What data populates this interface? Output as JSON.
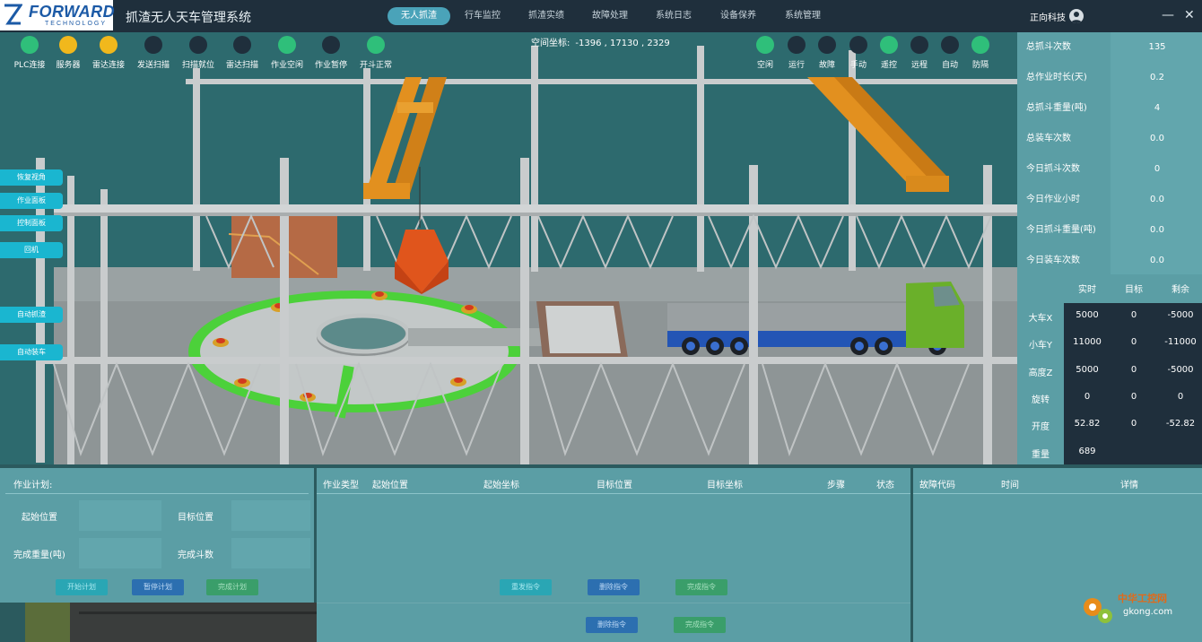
{
  "app": {
    "logo_brand": "FORWARD",
    "logo_sub": "TECHNOLOGY",
    "title": "抓渣无人天车管理系统",
    "user": "正向科技"
  },
  "menu": [
    "无人抓渣",
    "行车监控",
    "抓渣实绩",
    "故障处理",
    "系统日志",
    "设备保养",
    "系统管理"
  ],
  "indicators_left": [
    {
      "label": "PLC连接",
      "color": "green"
    },
    {
      "label": "服务器",
      "color": "yellow"
    },
    {
      "label": "雷达连接",
      "color": "yellow"
    },
    {
      "label": "发送扫描",
      "color": "dark"
    },
    {
      "label": "扫描就位",
      "color": "dark"
    },
    {
      "label": "雷达扫描",
      "color": "dark"
    },
    {
      "label": "作业空闲",
      "color": "green"
    },
    {
      "label": "作业暂停",
      "color": "dark"
    },
    {
      "label": "开斗正常",
      "color": "green"
    }
  ],
  "coords": {
    "label": "空间坐标:",
    "value": "-1396 , 17130 , 2329"
  },
  "indicators_right": [
    {
      "label": "空闲",
      "color": "green"
    },
    {
      "label": "运行",
      "color": "dark"
    },
    {
      "label": "故障",
      "color": "dark"
    },
    {
      "label": "手动",
      "color": "dark"
    },
    {
      "label": "遥控",
      "color": "green"
    },
    {
      "label": "远程",
      "color": "dark"
    },
    {
      "label": "自动",
      "color": "dark"
    },
    {
      "label": "防隔",
      "color": "green"
    }
  ],
  "side_buttons": [
    "恢复视角",
    "作业面板",
    "控制面板",
    "回机",
    "自动抓渣",
    "自动装车"
  ],
  "stats": [
    {
      "label": "总抓斗次数",
      "value": "135"
    },
    {
      "label": "总作业时长(天)",
      "value": "0.2"
    },
    {
      "label": "总抓斗重量(吨)",
      "value": "4"
    },
    {
      "label": "总装车次数",
      "value": "0.0"
    },
    {
      "label": "今日抓斗次数",
      "value": "0"
    },
    {
      "label": "今日作业小时",
      "value": "0.0"
    },
    {
      "label": "今日抓斗重量(吨)",
      "value": "0.0"
    },
    {
      "label": "今日装车次数",
      "value": "0.0"
    }
  ],
  "position_table": {
    "headers": [
      "实时",
      "目标",
      "剩余"
    ],
    "rows": [
      {
        "label": "大车X",
        "values": [
          "5000",
          "0",
          "-5000"
        ]
      },
      {
        "label": "小车Y",
        "values": [
          "11000",
          "0",
          "-11000"
        ]
      },
      {
        "label": "高度Z",
        "values": [
          "5000",
          "0",
          "-5000"
        ]
      },
      {
        "label": "旋转",
        "values": [
          "0",
          "0",
          "0"
        ]
      },
      {
        "label": "开度",
        "values": [
          "52.82",
          "0",
          "-52.82"
        ]
      },
      {
        "label": "重量",
        "values": [
          "689",
          "",
          ""
        ]
      }
    ]
  },
  "plan": {
    "title": "作业计划:",
    "start_label": "起始位置",
    "target_label": "目标位置",
    "weight_label": "完成重量(吨)",
    "buckets_label": "完成斗数",
    "buttons": [
      "开始计划",
      "暂停计划",
      "完成计划"
    ]
  },
  "commands": {
    "headers": [
      "作业类型",
      "起始位置",
      "起始坐标",
      "目标位置",
      "目标坐标",
      "步骤",
      "状态"
    ],
    "buttons": [
      "重发指令",
      "删除指令",
      "完成指令"
    ],
    "buttons2": [
      "删除指令",
      "完成指令"
    ]
  },
  "faults": {
    "headers": [
      "故障代码",
      "时间",
      "详情"
    ]
  },
  "watermark": {
    "text": "中华工控网",
    "url": "gkong.com"
  },
  "colors": {
    "accent": "#4aa3b9",
    "green": "#2fbf7a",
    "yellow": "#f1b81c",
    "panel": "#5b9ea5",
    "dark": "#1f2f3c"
  }
}
